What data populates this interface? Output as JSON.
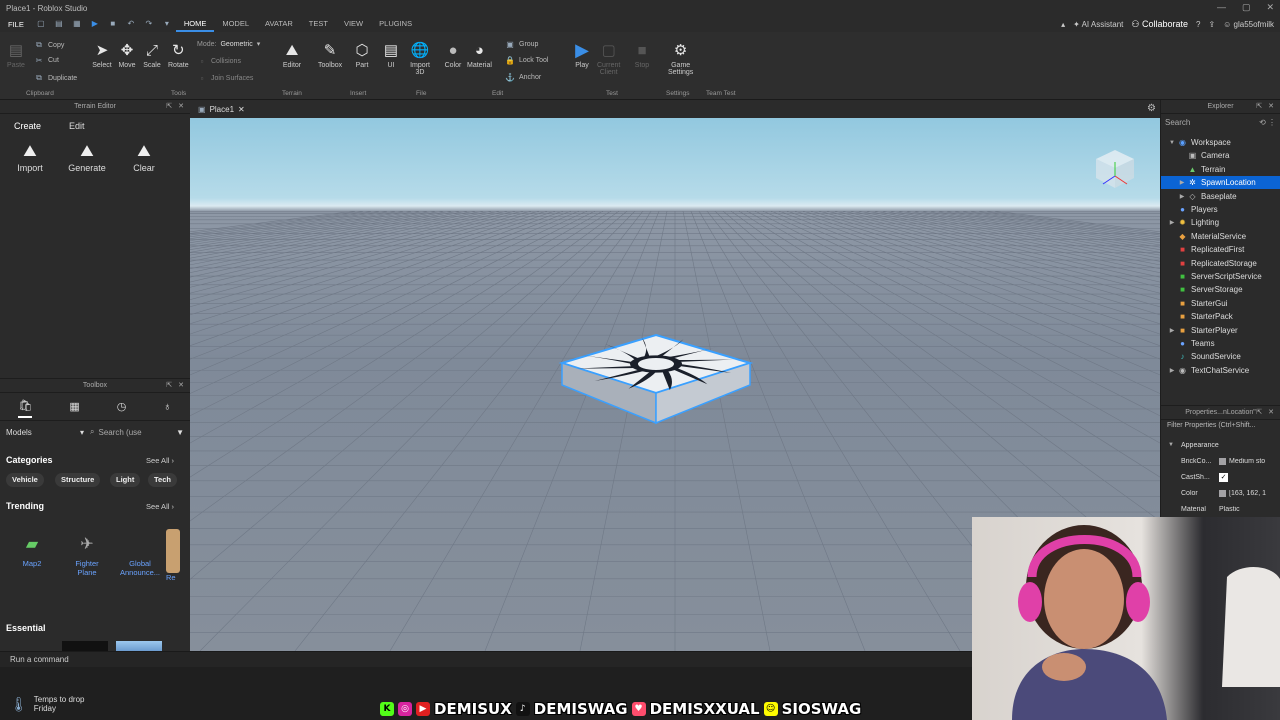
{
  "window": {
    "title": "Place1 - Roblox Studio",
    "controls": [
      "—",
      "▢",
      "✕"
    ]
  },
  "menu": {
    "file": "FILE",
    "tabs": [
      "HOME",
      "MODEL",
      "AVATAR",
      "TEST",
      "VIEW",
      "PLUGINS"
    ],
    "active_tab": "HOME",
    "ai_assistant": "AI Assistant",
    "collaborate": "Collaborate",
    "username": "gla55ofmilk"
  },
  "ribbon": {
    "clipboard": {
      "copy": "Copy",
      "cut": "Cut",
      "paste": "Paste",
      "duplicate": "Duplicate",
      "group": "Clipboard"
    },
    "tools": {
      "select": "Select",
      "move": "Move",
      "scale": "Scale",
      "rotate": "Rotate",
      "mode_label": "Mode:",
      "mode_value": "Geometric",
      "collisions": "Collisions",
      "join_surfaces": "Join Surfaces",
      "group": "Tools"
    },
    "terrain": {
      "editor": "Editor",
      "group": "Terrain"
    },
    "insert": {
      "toolbox": "Toolbox",
      "part": "Part",
      "ui": "UI",
      "group": "Insert"
    },
    "file": {
      "import3d_line1": "Import",
      "import3d_line2": "3D",
      "group": "File"
    },
    "edit": {
      "color": "Color",
      "material": "Material",
      "group_btn": "Group",
      "lock_tool": "Lock Tool",
      "anchor": "Anchor",
      "group": "Edit"
    },
    "test": {
      "play": "Play",
      "current_client_1": "Current",
      "current_client_2": "Client",
      "stop": "Stop",
      "group": "Test"
    },
    "settings": {
      "game_settings_1": "Game",
      "game_settings_2": "Settings",
      "group": "Settings"
    },
    "team_test": {
      "group": "Team Test"
    }
  },
  "terrain_editor": {
    "title": "Terrain Editor",
    "tabs": [
      "Create",
      "Edit"
    ],
    "tools": [
      "Import",
      "Generate",
      "Clear"
    ]
  },
  "toolbox": {
    "title": "Toolbox",
    "category_select": "Models",
    "search_placeholder": "Search (use",
    "categories_title": "Categories",
    "see_all": "See All",
    "chips": [
      "Vehicle",
      "Structure",
      "Light",
      "Tech"
    ],
    "trending_title": "Trending",
    "trending": [
      {
        "line1": "Map2",
        "line2": ""
      },
      {
        "line1": "Fighter",
        "line2": "Plane"
      },
      {
        "line1": "Global",
        "line2": "Announce..."
      },
      {
        "line1": "Re",
        "line2": ""
      }
    ],
    "essential_title": "Essential"
  },
  "viewport": {
    "tab": "Place1"
  },
  "explorer": {
    "title": "Explorer",
    "search_placeholder": "Search",
    "items": [
      {
        "label": "Workspace",
        "level": 0,
        "arrow": "▼",
        "icon": "workspace-icon",
        "glyph": "◉",
        "color": "#5aa0ff"
      },
      {
        "label": "Camera",
        "level": 1,
        "arrow": "",
        "icon": "camera-icon",
        "glyph": "▣",
        "color": "#bbbbbb"
      },
      {
        "label": "Terrain",
        "level": 1,
        "arrow": "",
        "icon": "terrain-icon",
        "glyph": "▲",
        "color": "#6ccb6c"
      },
      {
        "label": "SpawnLocation",
        "level": 1,
        "arrow": "▶",
        "icon": "spawn-icon",
        "glyph": "✲",
        "color": "#ffffff",
        "selected": true
      },
      {
        "label": "Baseplate",
        "level": 1,
        "arrow": "▶",
        "icon": "part-icon",
        "glyph": "◇",
        "color": "#bbbbbb"
      },
      {
        "label": "Players",
        "level": 0,
        "arrow": "",
        "icon": "players-icon",
        "glyph": "●",
        "color": "#6aa3ff"
      },
      {
        "label": "Lighting",
        "level": 0,
        "arrow": "▶",
        "icon": "lighting-icon",
        "glyph": "✹",
        "color": "#f0c040"
      },
      {
        "label": "MaterialService",
        "level": 0,
        "arrow": "",
        "icon": "material-service-icon",
        "glyph": "◆",
        "color": "#e8a040"
      },
      {
        "label": "ReplicatedFirst",
        "level": 0,
        "arrow": "",
        "icon": "replicated-first-icon",
        "glyph": "■",
        "color": "#e04040"
      },
      {
        "label": "ReplicatedStorage",
        "level": 0,
        "arrow": "",
        "icon": "replicated-storage-icon",
        "glyph": "■",
        "color": "#e04040"
      },
      {
        "label": "ServerScriptService",
        "level": 0,
        "arrow": "",
        "icon": "server-script-icon",
        "glyph": "■",
        "color": "#40c040"
      },
      {
        "label": "ServerStorage",
        "level": 0,
        "arrow": "",
        "icon": "server-storage-icon",
        "glyph": "■",
        "color": "#40c040"
      },
      {
        "label": "StarterGui",
        "level": 0,
        "arrow": "",
        "icon": "starter-gui-icon",
        "glyph": "■",
        "color": "#e8a040"
      },
      {
        "label": "StarterPack",
        "level": 0,
        "arrow": "",
        "icon": "starter-pack-icon",
        "glyph": "■",
        "color": "#e8a040"
      },
      {
        "label": "StarterPlayer",
        "level": 0,
        "arrow": "▶",
        "icon": "starter-player-icon",
        "glyph": "■",
        "color": "#e8a040"
      },
      {
        "label": "Teams",
        "level": 0,
        "arrow": "",
        "icon": "teams-icon",
        "glyph": "●",
        "color": "#6aa3ff"
      },
      {
        "label": "SoundService",
        "level": 0,
        "arrow": "",
        "icon": "sound-service-icon",
        "glyph": "♪",
        "color": "#40c0c0"
      },
      {
        "label": "TextChatService",
        "level": 0,
        "arrow": "▶",
        "icon": "text-chat-icon",
        "glyph": "◉",
        "color": "#bbbbbb"
      }
    ]
  },
  "properties": {
    "title": "Properties...nLocation\"",
    "filter_placeholder": "Filter Properties (Ctrl+Shift...",
    "section": "Appearance",
    "rows": [
      {
        "name": "BrickCo...",
        "value": "Medium sto",
        "swatch": true,
        "check": false
      },
      {
        "name": "CastSh...",
        "value": "",
        "swatch": false,
        "check": true
      },
      {
        "name": "Color",
        "value": "[163, 162, 1",
        "swatch": true,
        "check": false
      },
      {
        "name": "Material",
        "value": "Plastic",
        "swatch": false,
        "check": false
      }
    ]
  },
  "command_bar": {
    "placeholder": "Run a command"
  },
  "taskbar": {
    "weather_line1": "Temps to drop",
    "weather_line2": "Friday"
  },
  "banner": {
    "handles": [
      "DEMISUX",
      "DEMISWAG",
      "DEMISXXUAL",
      "SIOSWAG"
    ]
  },
  "colors": {
    "accent": "#0b64d4",
    "play": "#3a8ee6",
    "selection_outline": "#3aa0ff"
  }
}
